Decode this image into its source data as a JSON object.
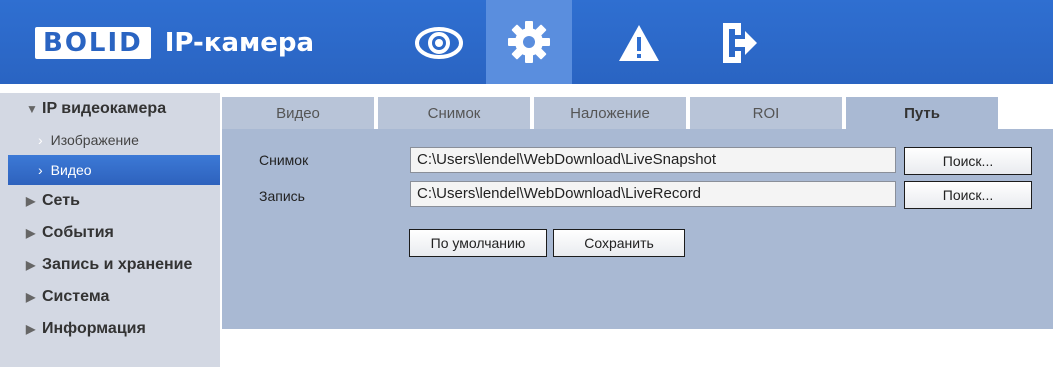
{
  "header": {
    "logo_text": "BOLID",
    "app_title": "IP-камера",
    "nav": [
      {
        "name": "live-view",
        "icon": "eye-icon"
      },
      {
        "name": "settings",
        "icon": "gear-icon"
      },
      {
        "name": "alarm",
        "icon": "warning-icon"
      },
      {
        "name": "logout",
        "icon": "exit-icon"
      }
    ],
    "colors": {
      "header_bg": "#2f6fd1",
      "active_nav_bg": "#5a8ede"
    }
  },
  "sidebar": {
    "sections": [
      {
        "label": "IP видеокамера",
        "expanded": true
      },
      {
        "label": "Сеть",
        "expanded": false
      },
      {
        "label": "События",
        "expanded": false
      },
      {
        "label": "Запись и хранение",
        "expanded": false
      },
      {
        "label": "Система",
        "expanded": false
      },
      {
        "label": "Информация",
        "expanded": false
      }
    ],
    "sub_items": [
      {
        "label": "Изображение",
        "active": false
      },
      {
        "label": "Видео",
        "active": true
      }
    ]
  },
  "tabs": [
    {
      "label": "Видео",
      "active": false
    },
    {
      "label": "Снимок",
      "active": false
    },
    {
      "label": "Наложение",
      "active": false
    },
    {
      "label": "ROI",
      "active": false
    },
    {
      "label": "Путь",
      "active": true
    }
  ],
  "form": {
    "snapshot": {
      "label": "Снимок",
      "value": "C:\\Users\\lendel\\WebDownload\\LiveSnapshot",
      "browse_label": "Поиск..."
    },
    "record": {
      "label": "Запись",
      "value": "C:\\Users\\lendel\\WebDownload\\LiveRecord",
      "browse_label": "Поиск..."
    },
    "default_label": "По умолчанию",
    "save_label": "Сохранить"
  }
}
